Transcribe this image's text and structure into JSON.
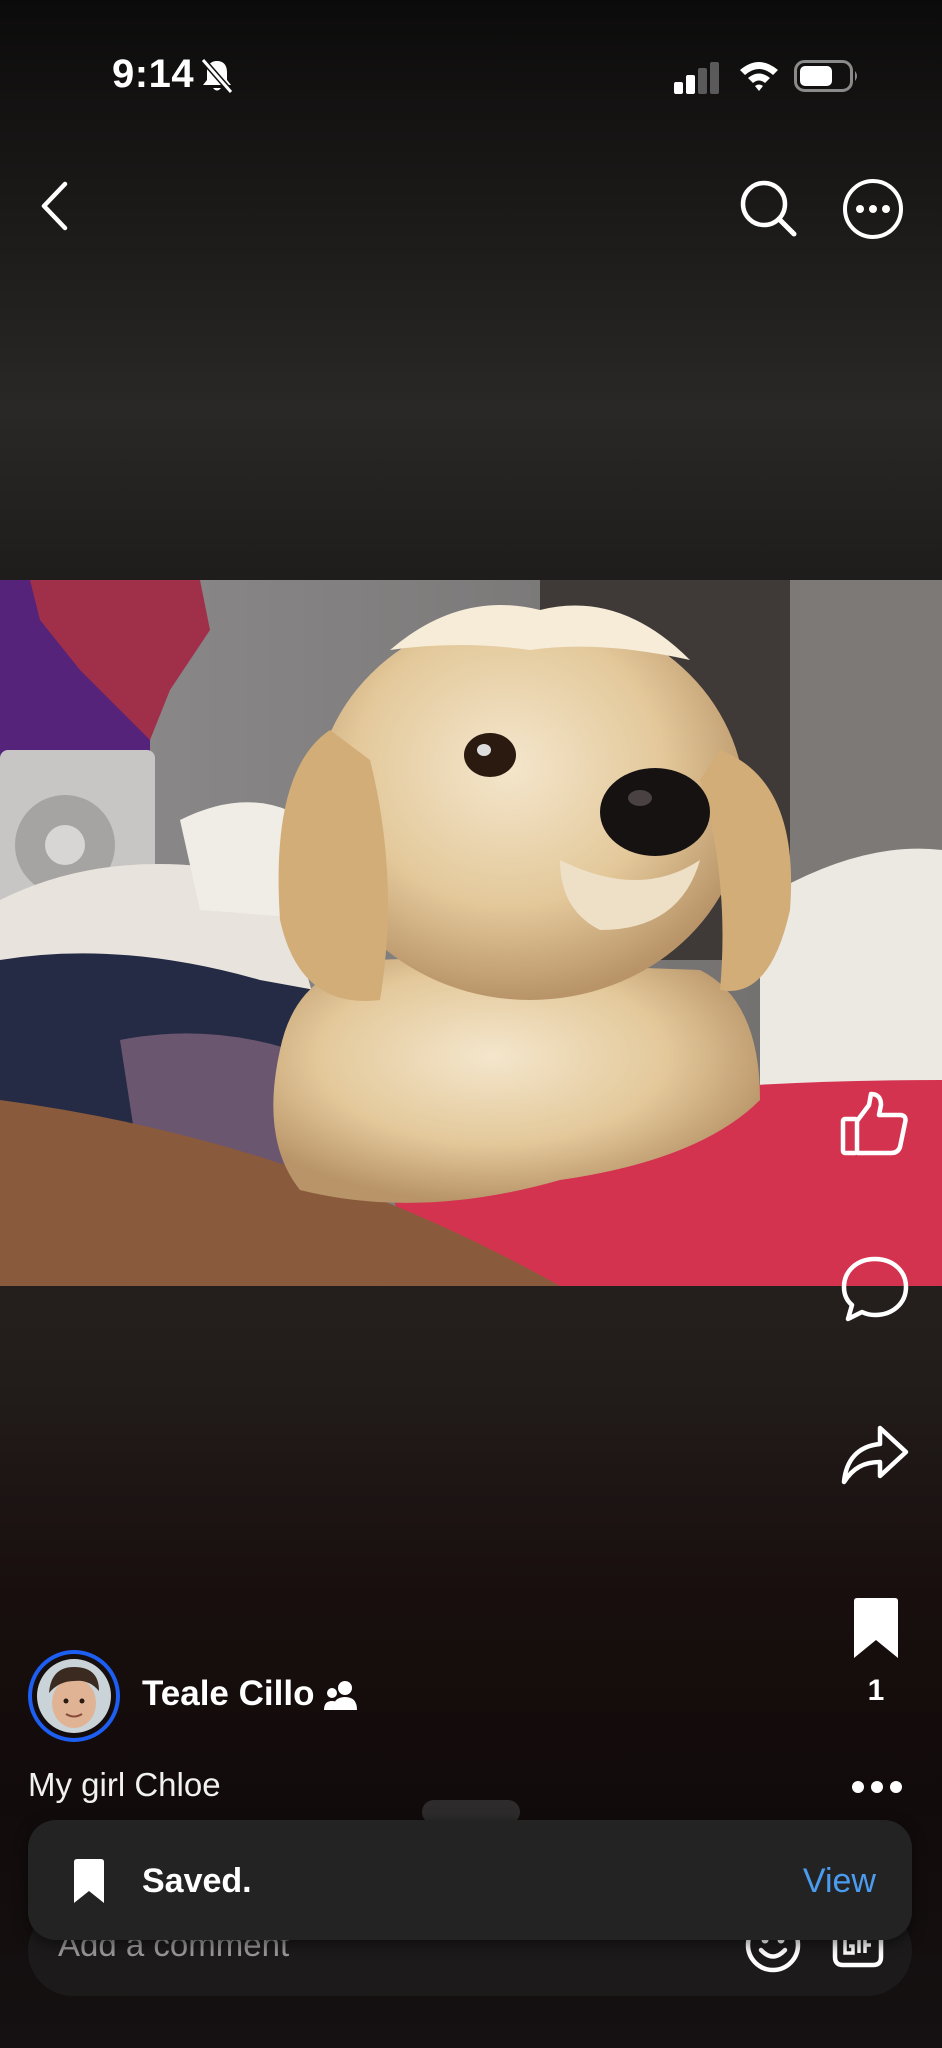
{
  "status_bar": {
    "time": "9:14",
    "icons": [
      "bell-slash-icon",
      "cellular-signal-icon",
      "wifi-icon",
      "battery-icon"
    ]
  },
  "top_bar": {
    "icons": [
      "chevron-left-icon",
      "search-icon",
      "more-horizontal-circle-icon"
    ]
  },
  "post": {
    "photo": "dog-photo",
    "author": "Teale Cillo",
    "author_badge_icon": "friends-icon",
    "caption": "My girl Chloe",
    "save_count": "1"
  },
  "actions": {
    "icons": [
      "thumbs-up-icon",
      "comment-icon",
      "share-icon",
      "bookmark-icon"
    ]
  },
  "comment_bar": {
    "placeholder": "Add a comment",
    "icons": [
      "emoji-icon",
      "gif-icon"
    ]
  },
  "toast": {
    "icon": "bookmark-icon",
    "message": "Saved.",
    "action": "View"
  },
  "colors": {
    "accent_ring": "#1d5ff2",
    "link": "#4a9cf0",
    "toast_bg": "#232324"
  }
}
